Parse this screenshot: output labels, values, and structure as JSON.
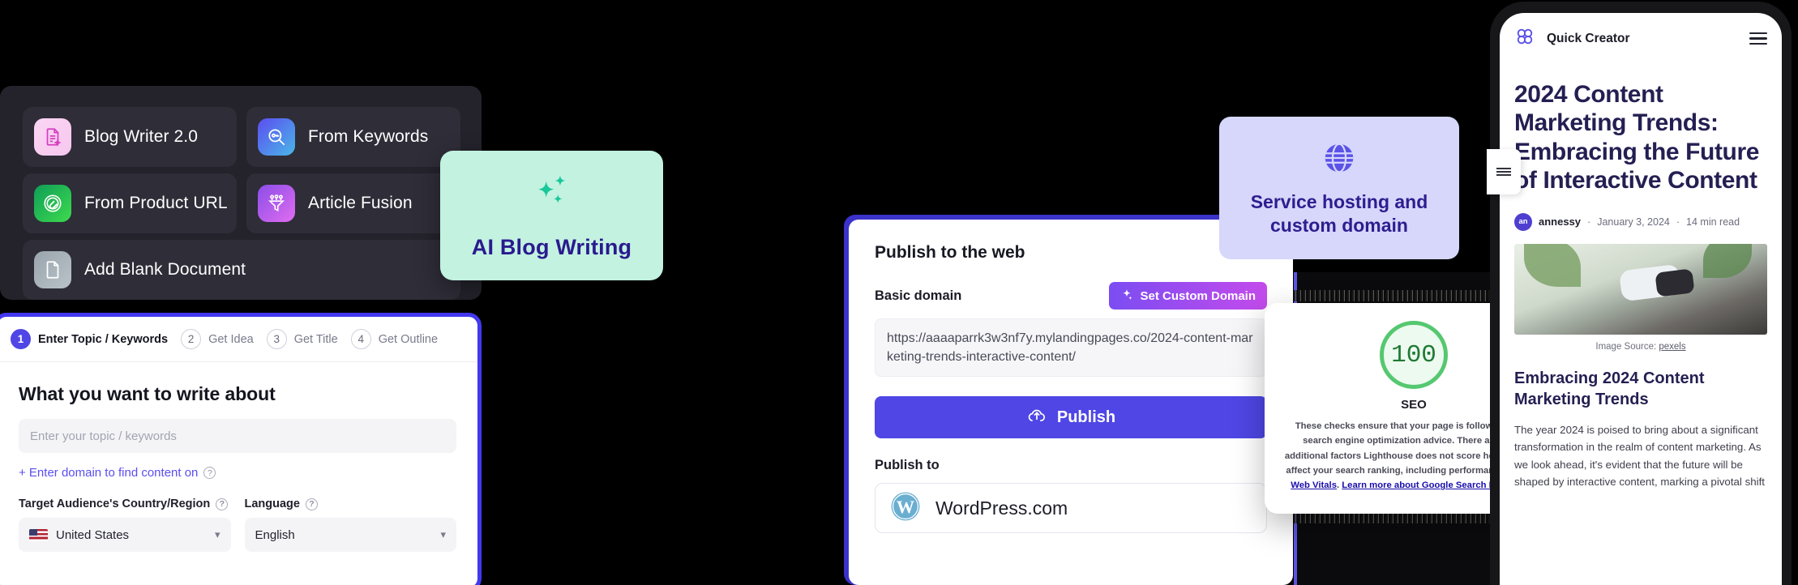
{
  "dark_panel": {
    "items": [
      {
        "label": "Blog Writer 2.0",
        "icon": "document-sparkle-icon"
      },
      {
        "label": "From Keywords",
        "icon": "magnifier-key-icon"
      },
      {
        "label": "From Product URL",
        "icon": "link-circle-icon"
      },
      {
        "label": "Article Fusion",
        "icon": "funnel-icon"
      },
      {
        "label": "Add Blank Document",
        "icon": "blank-document-icon"
      }
    ]
  },
  "mint_card": {
    "title": "AI Blog Writing",
    "icon": "sparkles-icon",
    "bg_color": "#c3f2e0",
    "text_color": "#2a1a8f"
  },
  "wizard": {
    "steps": [
      {
        "num": "1",
        "label": "Enter Topic / Keywords",
        "active": true
      },
      {
        "num": "2",
        "label": "Get Idea",
        "active": false
      },
      {
        "num": "3",
        "label": "Get Title",
        "active": false
      },
      {
        "num": "4",
        "label": "Get Outline",
        "active": false
      }
    ],
    "heading": "What you want to write about",
    "topic_input": {
      "value": "",
      "placeholder": "Enter your topic / keywords"
    },
    "domain_link": "+ Enter domain to find content on",
    "country": {
      "label": "Target Audience's Country/Region",
      "value": "United States",
      "flag": "us-flag-icon"
    },
    "language": {
      "label": "Language",
      "value": "English"
    },
    "help_glyph": "?",
    "accent_color": "#4338ef"
  },
  "publish_panel": {
    "title": "Publish to the web",
    "basic_domain_label": "Basic domain",
    "custom_domain_button": "Set Custom Domain",
    "custom_domain_icon": "sparkle-icon",
    "url_value": "https://aaaaparrk3w3nf7y.mylandingpages.co/2024-content-marketing-trends-interactive-content/",
    "publish_button": "Publish",
    "publish_icon": "cloud-upload-icon",
    "publish_to_label": "Publish to",
    "destination": {
      "name": "WordPress.com",
      "icon": "wordpress-icon"
    },
    "accent_color": "#4f46e5"
  },
  "lilac_card": {
    "title_line1": "Service hosting and",
    "title_line2": "custom domain",
    "icon": "globe-icon",
    "bg_color": "#d6d7fb",
    "text_color": "#2e1d8f"
  },
  "seo_card": {
    "score": "100",
    "label": "SEO",
    "ring_color": "#55c870",
    "score_color": "#1f7a33",
    "description_part1": "These checks ensure that your page is following basic search engine optimization advice. There are many additional factors Lighthouse does not score here that may affect your search ranking, including performance on ",
    "link1": "Core Web Vitals",
    "description_part2": ". ",
    "link2": "Learn more about Google Search Essentials",
    "description_part3": "."
  },
  "phone": {
    "brand": "Quick Creator",
    "brand_icon": "quick-creator-logo-icon",
    "menu_icon": "hamburger-menu-icon",
    "side_tab_icon": "side-menu-icon",
    "article_title": "2024 Content Marketing Trends: Embracing the Future of Interactive Content",
    "author_initials": "an",
    "author": "annessy",
    "date": "January 3, 2024",
    "read_time": "14 min read",
    "meta_sep": "·",
    "image_source_prefix": "Image Source: ",
    "image_source_link": "pexels",
    "section_heading": "Embracing 2024 Content Marketing Trends",
    "body_paragraph": "The year 2024 is poised to bring about a significant transformation in the realm of content marketing. As we look ahead, it's evident that the future will be shaped by interactive content, marking a pivotal shift"
  }
}
